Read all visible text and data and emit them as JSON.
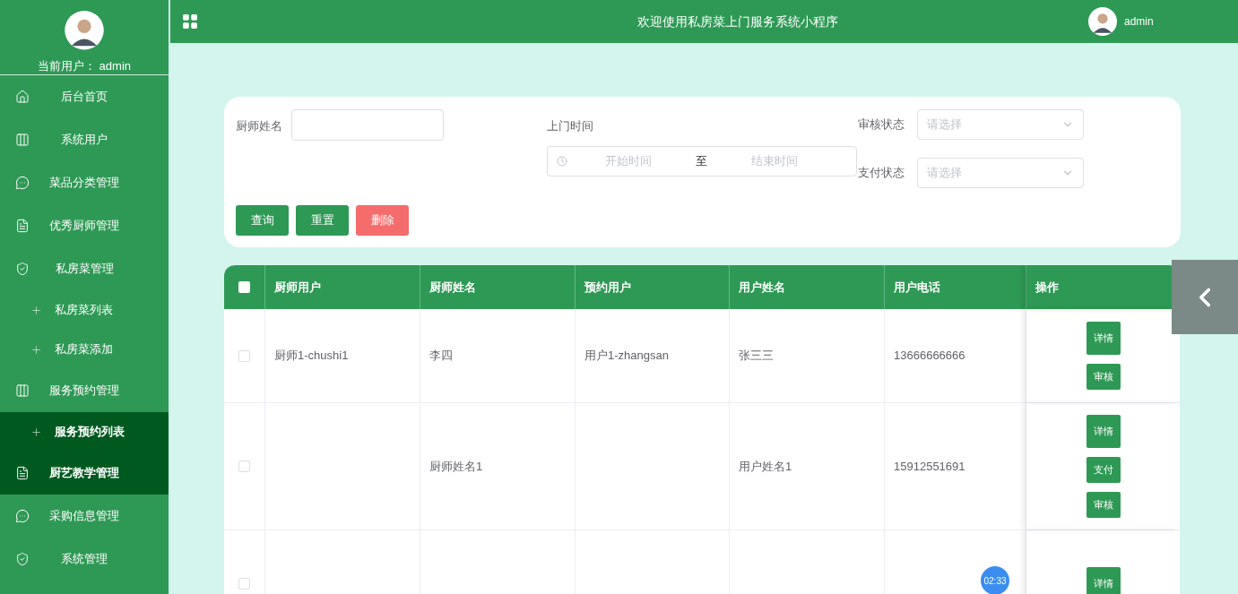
{
  "sidebar": {
    "user_label": "当前用户：",
    "user_name": "admin",
    "items": [
      {
        "label": "后台首页",
        "selected": false,
        "hovered": false
      },
      {
        "label": "系统用户",
        "selected": false,
        "hovered": false
      },
      {
        "label": "菜品分类管理",
        "selected": false,
        "hovered": false
      },
      {
        "label": "优秀厨师管理",
        "selected": false,
        "hovered": false
      },
      {
        "label": "私房菜管理",
        "selected": false,
        "hovered": false,
        "children": [
          {
            "label": "私房菜列表",
            "selected": false
          },
          {
            "label": "私房菜添加",
            "selected": false
          }
        ]
      },
      {
        "label": "服务预约管理",
        "selected": false,
        "hovered": false,
        "children": [
          {
            "label": "服务预约列表",
            "selected": true
          }
        ]
      },
      {
        "label": "厨艺教学管理",
        "selected": false,
        "hovered": true
      },
      {
        "label": "采购信息管理",
        "selected": false,
        "hovered": false
      },
      {
        "label": "系统管理",
        "selected": false,
        "hovered": false
      }
    ]
  },
  "header": {
    "title": "欢迎使用私房菜上门服务系统小程序",
    "user": "admin"
  },
  "search": {
    "chef_name": {
      "label": "厨师姓名"
    },
    "visit_time": {
      "label": "上门时间",
      "start_placeholder": "开始时间",
      "separator": "至",
      "end_placeholder": "结束时间"
    },
    "review_status": {
      "label": "审核状态",
      "placeholder": "请选择"
    },
    "pay_status": {
      "label": "支付状态",
      "placeholder": "请选择"
    },
    "buttons": [
      {
        "label": "查询",
        "kind": "primary"
      },
      {
        "label": "重置",
        "kind": "primary"
      },
      {
        "label": "删除",
        "kind": "danger"
      }
    ]
  },
  "table": {
    "all_checked": false,
    "columns": [
      "厨师用户",
      "厨师姓名",
      "预约用户",
      "用户姓名",
      "用户电话",
      "操作"
    ],
    "rows": [
      {
        "checked": false,
        "cells": [
          "厨师1-chushi1",
          "李四",
          "用户1-zhangsan",
          "张三三",
          "13666666666"
        ],
        "actions": [
          "详情",
          "审核"
        ]
      },
      {
        "checked": false,
        "cells": [
          null,
          "厨师姓名1",
          null,
          "用户姓名1",
          "15912551691"
        ],
        "actions": [
          "详情",
          "支付",
          "审核"
        ]
      },
      {
        "checked": false,
        "cells": [
          null,
          null,
          null,
          null,
          null
        ],
        "actions": [
          "详情"
        ]
      }
    ]
  },
  "recorder": {
    "time": "02:33"
  }
}
